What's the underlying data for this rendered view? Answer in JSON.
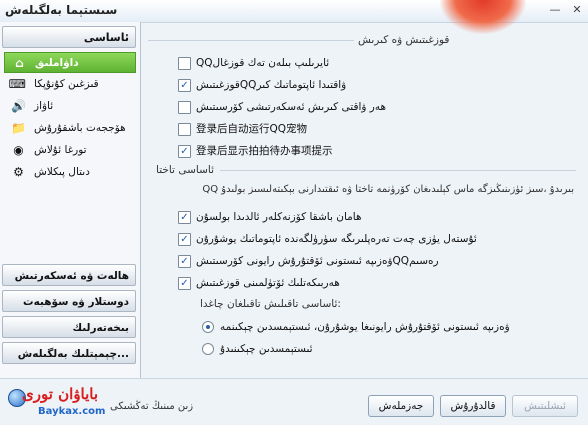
{
  "window": {
    "title": "سىستېما بەلگىلەش",
    "minimize_glyph": "—",
    "close_glyph": "✕"
  },
  "sidebar": {
    "section_title": "ئاساسى",
    "items": [
      {
        "label": "داۋاملىق",
        "icon": "home-icon",
        "glyph": "⌂"
      },
      {
        "label": "قىزغىن كۇنۇپكا",
        "icon": "keyboard-icon",
        "glyph": "⌨"
      },
      {
        "label": "ئاۋاز",
        "icon": "speaker-icon",
        "glyph": "🔊"
      },
      {
        "label": "ھۆججەت باشقۇرۇش",
        "icon": "folder-icon",
        "glyph": "📁"
      },
      {
        "label": "تورغا ئۇلاش",
        "icon": "network-icon",
        "glyph": "◉"
      },
      {
        "label": "دىتال پىكلاش",
        "icon": "settings-icon",
        "glyph": "⚙"
      }
    ],
    "bottom_sections": [
      "ھالەت ۋە ئەسكەرتىش",
      "دوستلار ۋە سۆھبەت",
      "بىخەتەرلىك",
      "...چېمېتلىك بەلگىلەش"
    ]
  },
  "content": {
    "group1_title": "قوزغىتىش ۋە كىرىش",
    "group1_options": [
      {
        "label": "QQئايرىلىپ بىلەن تەك قوزغال",
        "checked": false
      },
      {
        "label": "ۋاقتىدا ئاپتوماتىك كىرQQقوزغىتىش",
        "checked": true
      },
      {
        "label": "ھەر ۋاقتى كىرىش ئەسكەرتىشى كۆرسىتىش",
        "checked": false
      },
      {
        "label": "登录后自动运行QQ宠物",
        "checked": false
      },
      {
        "label": "登录后显示拍拍待办事项提示",
        "checked": true
      }
    ],
    "group2_title": "ئاساسى تاختا",
    "group2_note": "QQ بىرىدۇ ،سىز ئۈزىنىڭىزگە ماس كېلىدىغان كۆرۈنمە تاختا ۋە ئىقتىدارنى بېكىتەلىسىز بولىدۇ",
    "group2_options": [
      {
        "label": "ھامان باشقا كۆزنەكلەر ئالدىدا بولسۇن",
        "checked": true
      },
      {
        "label": "ئۇستەل يۈزى چەت تەرەپلىرىگە سۈرۈلگەندە ئاپتوماتىك يوشۇرۇن",
        "checked": true
      },
      {
        "label": "رەسىمQQۋەزىپە ئىستونى ئۆقتۇرۇش رايونى كۆرسىتىش",
        "checked": true
      },
      {
        "label": "ھەربىكەتلىك ئۆتۈلمىنى قوزغىتىش",
        "checked": true
      }
    ],
    "radio_group_title": ":ئاساسى تاقىلىش تاقىلغان چاغدا",
    "radio_options": [
      {
        "label": "ۋەزىپە ئىستونى ئۆقتۇرۇش رايونىغا يوشۇرۇن، ئىستېمسدىن چېكىنمە",
        "selected": true
      },
      {
        "label": "ئىستېمسدىن چېكىنىدۇ",
        "selected": false
      }
    ]
  },
  "footer": {
    "text": "زىن مىنىڭ تەڭشىكى",
    "watermark_top": "باياۋان تورى",
    "watermark_sub": "Baykax.com",
    "buttons": {
      "ok": "جەزملەش",
      "cancel": "قالدۇرۇش",
      "apply": "ئىشلىتىش"
    }
  }
}
